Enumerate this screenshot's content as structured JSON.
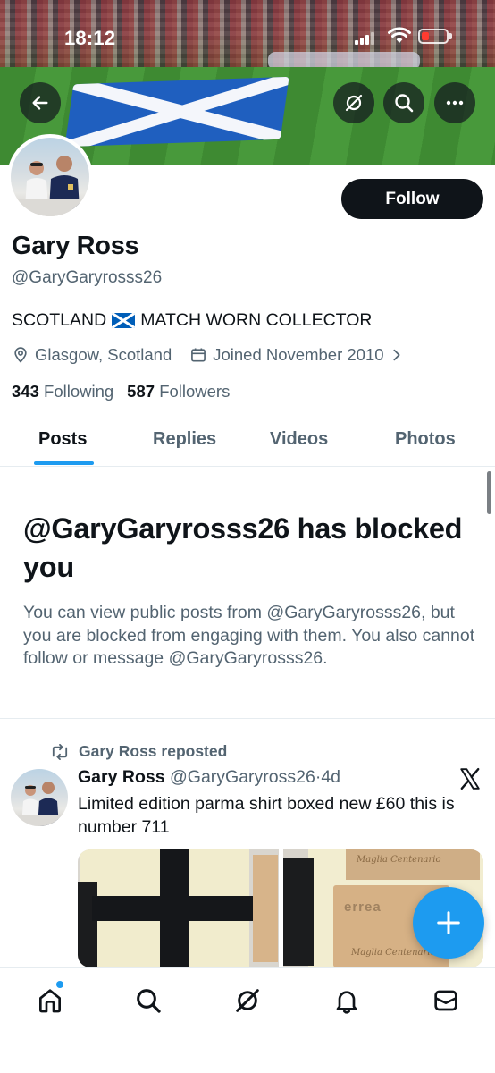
{
  "status_bar": {
    "time": "18:12"
  },
  "profile": {
    "display_name": "Gary Ross",
    "handle": "@GaryGaryrosss26",
    "bio_part1": "SCOTLAND",
    "bio_part2": "MATCH WORN COLLECTOR",
    "location": "Glasgow, Scotland",
    "joined": "Joined November 2010",
    "following_count": "343",
    "following_label": "Following",
    "followers_count": "587",
    "followers_label": "Followers",
    "follow_button": "Follow"
  },
  "tabs": [
    {
      "label": "Posts",
      "active": true
    },
    {
      "label": "Replies",
      "active": false
    },
    {
      "label": "Videos",
      "active": false
    },
    {
      "label": "Photos",
      "active": false
    }
  ],
  "blocked": {
    "title": "@GaryGaryrosss26 has blocked you",
    "description": "You can view public posts from @GaryGaryrosss26, but you are blocked from engaging with them. You also cannot follow or message @GaryGaryrosss26."
  },
  "post": {
    "repost_label": "Gary Ross reposted",
    "author_name": "Gary Ross",
    "author_handle": "@GaryGaryross26",
    "separator": "·",
    "time_ago": "4d",
    "text": "Limited edition parma shirt boxed new £60 this is number 711",
    "media_text": {
      "brand": "errea",
      "card_top": "Maglia Centenario",
      "card_bottom": "Maglia Centenario"
    }
  },
  "icons": {
    "back": "arrow-left-icon",
    "grok": "grok-icon",
    "search": "search-icon",
    "more": "more-icon",
    "location": "location-pin-icon",
    "calendar": "calendar-icon",
    "chevron": "chevron-right-icon",
    "repost": "repost-icon",
    "x_logo": "x-logo-icon",
    "compose": "plus-icon",
    "nav": [
      "home-icon",
      "search-icon",
      "grok-icon",
      "notifications-icon",
      "messages-icon"
    ]
  },
  "colors": {
    "accent": "#1d9bf0",
    "text_primary": "#0f1419",
    "text_secondary": "#536471",
    "follow_bg": "#0f1419",
    "battery_low": "#ff3b30"
  }
}
